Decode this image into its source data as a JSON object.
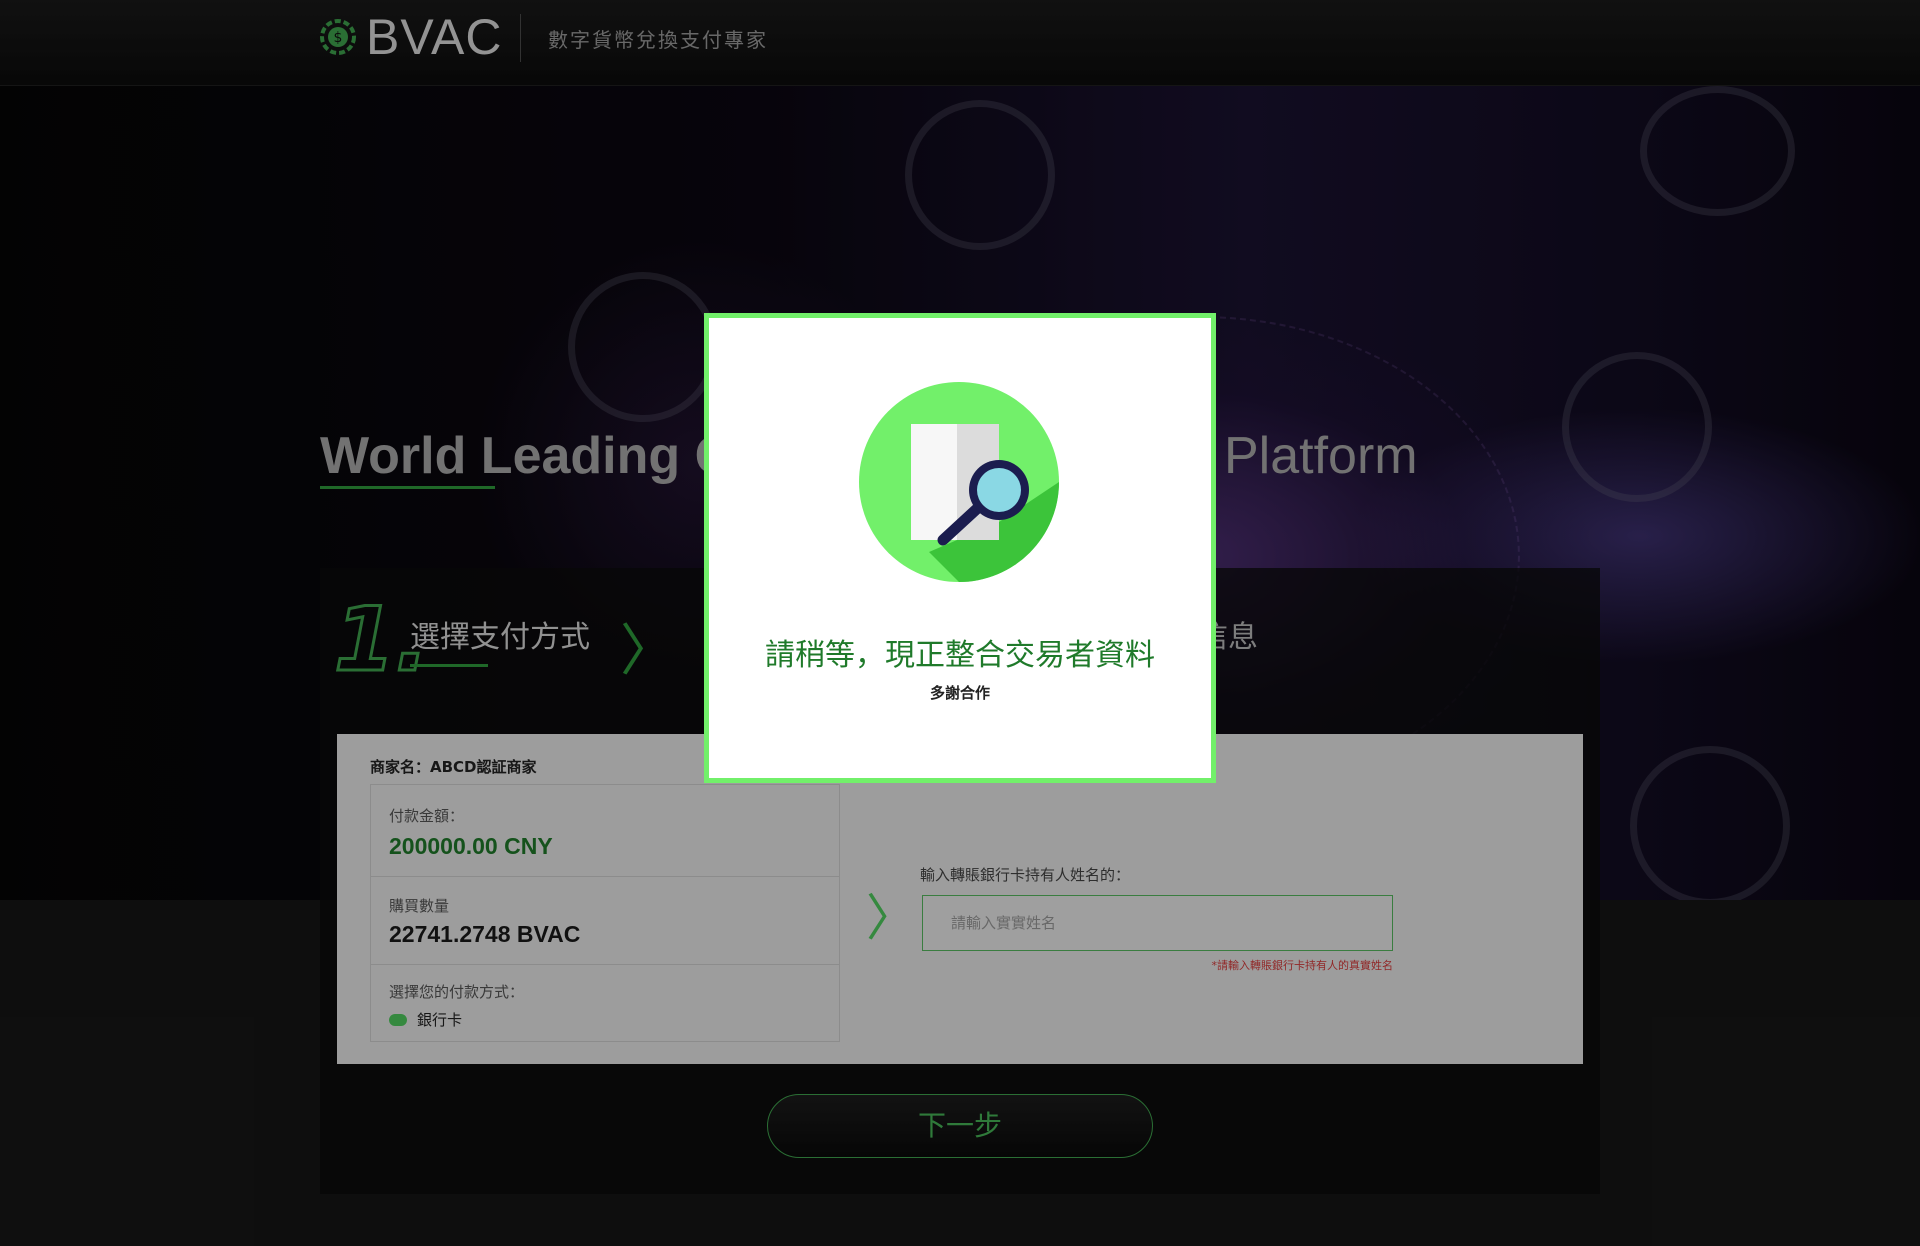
{
  "header": {
    "brand": "BVAC",
    "tagline": "數字貨幣兌換支付專家"
  },
  "hero": {
    "title_left": "World Leading C",
    "title_right": "Platform"
  },
  "steps": {
    "step1_number": "1.",
    "step1_label": "選擇支付方式",
    "step_right_partial": "信息"
  },
  "form": {
    "merchant": "商家名：ABCD認証商家",
    "amount_label": "付款金額：",
    "amount_value": "200000.00 CNY",
    "quantity_label": "購買數量",
    "quantity_value": "22741.2748 BVAC",
    "method_label": "選擇您的付款方式：",
    "method_value": "銀行卡",
    "name_label": "輸入轉賬銀行卡持有人姓名的：",
    "name_placeholder": "請輸入實實姓名",
    "name_hint": "*請輸入轉賬銀行卡持有人的真實姓名",
    "next_button": "下一步"
  },
  "modal": {
    "title": "請稍等，現正整合交易者資料",
    "subtitle": "多謝合作",
    "illustration": "document-search-icon"
  },
  "colors": {
    "accent": "#3fa34d",
    "modal_border": "#72f06a",
    "amount_green": "#1f7a2a",
    "hint_red": "#d63b3b"
  }
}
